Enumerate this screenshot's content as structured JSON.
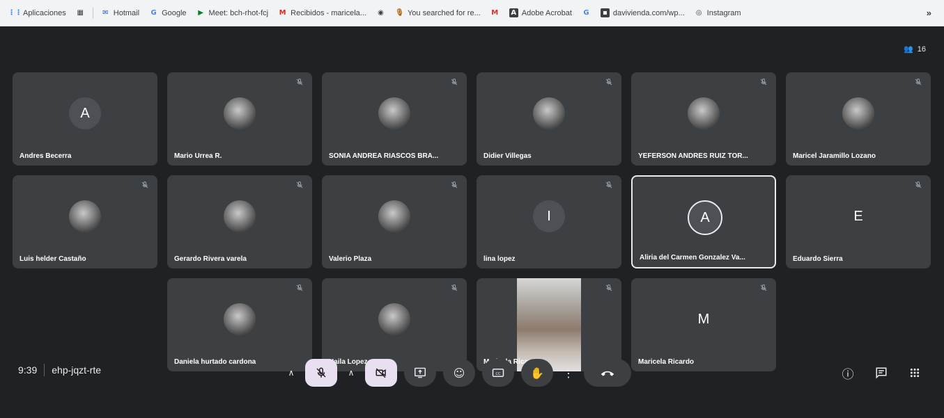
{
  "bookmarks": {
    "items": [
      {
        "label": "Aplicaciones",
        "icon": "apps-grid-icon"
      },
      {
        "label": "",
        "icon": "grid-icon"
      },
      {
        "label": "Hotmail",
        "icon": "hotmail-icon"
      },
      {
        "label": "Google",
        "icon": "google-icon"
      },
      {
        "label": "Meet: bch-rhot-fcj",
        "icon": "meet-icon"
      },
      {
        "label": "Recibidos - maricela...",
        "icon": "gmail-icon"
      },
      {
        "label": "",
        "icon": "chrome-icon"
      },
      {
        "label": "You searched for re...",
        "icon": "mic-bookmark-icon"
      },
      {
        "label": "",
        "icon": "gmail-icon"
      },
      {
        "label": "Adobe Acrobat",
        "icon": "adobe-icon"
      },
      {
        "label": "",
        "icon": "google-icon"
      },
      {
        "label": "davivienda.com/wp...",
        "icon": "davivienda-icon"
      },
      {
        "label": "Instagram",
        "icon": "instagram-icon"
      }
    ],
    "more": "»"
  },
  "meeting": {
    "participant_count": "16",
    "time": "9:39",
    "code": "ehp-jqzt-rte"
  },
  "participants": [
    {
      "name": "Andres Becerra",
      "avatar": "letter",
      "letter": "A",
      "muted": false
    },
    {
      "name": "Mario Urrea R.",
      "avatar": "photo",
      "letter": "",
      "muted": true
    },
    {
      "name": "SONIA ANDREA RIASCOS BRA...",
      "avatar": "photo",
      "letter": "",
      "muted": true
    },
    {
      "name": "Didier Villegas",
      "avatar": "photo",
      "letter": "",
      "muted": true
    },
    {
      "name": "YEFERSON ANDRES RUIZ TOR...",
      "avatar": "photo",
      "letter": "",
      "muted": true
    },
    {
      "name": "Maricel Jaramillo Lozano",
      "avatar": "photo",
      "letter": "",
      "muted": true
    },
    {
      "name": "Luis helder Castaño",
      "avatar": "photo",
      "letter": "",
      "muted": true
    },
    {
      "name": "Gerardo Rivera varela",
      "avatar": "photo",
      "letter": "",
      "muted": true
    },
    {
      "name": "Valerio Plaza",
      "avatar": "photo",
      "letter": "",
      "muted": true
    },
    {
      "name": "lina lopez",
      "avatar": "letter",
      "letter": "I",
      "muted": true
    },
    {
      "name": "Aliria del Carmen Gonzalez Va...",
      "avatar": "ring",
      "letter": "A",
      "muted": false
    },
    {
      "name": "Eduardo Sierra",
      "avatar": "plain",
      "letter": "E",
      "muted": true
    },
    {
      "name": "Daniela hurtado cardona",
      "avatar": "photo",
      "letter": "",
      "muted": true
    },
    {
      "name": "Naila Lopez",
      "avatar": "photo",
      "letter": "",
      "muted": true
    },
    {
      "name": "Maricela Ricardo",
      "avatar": "video",
      "letter": "",
      "muted": true
    },
    {
      "name": "Maricela Ricardo",
      "avatar": "plain",
      "letter": "M",
      "muted": true
    }
  ],
  "colors": {
    "background": "#202124",
    "tile": "#3c4043",
    "highlight_button": "#e8e0f0",
    "text": "#e8eaed"
  }
}
